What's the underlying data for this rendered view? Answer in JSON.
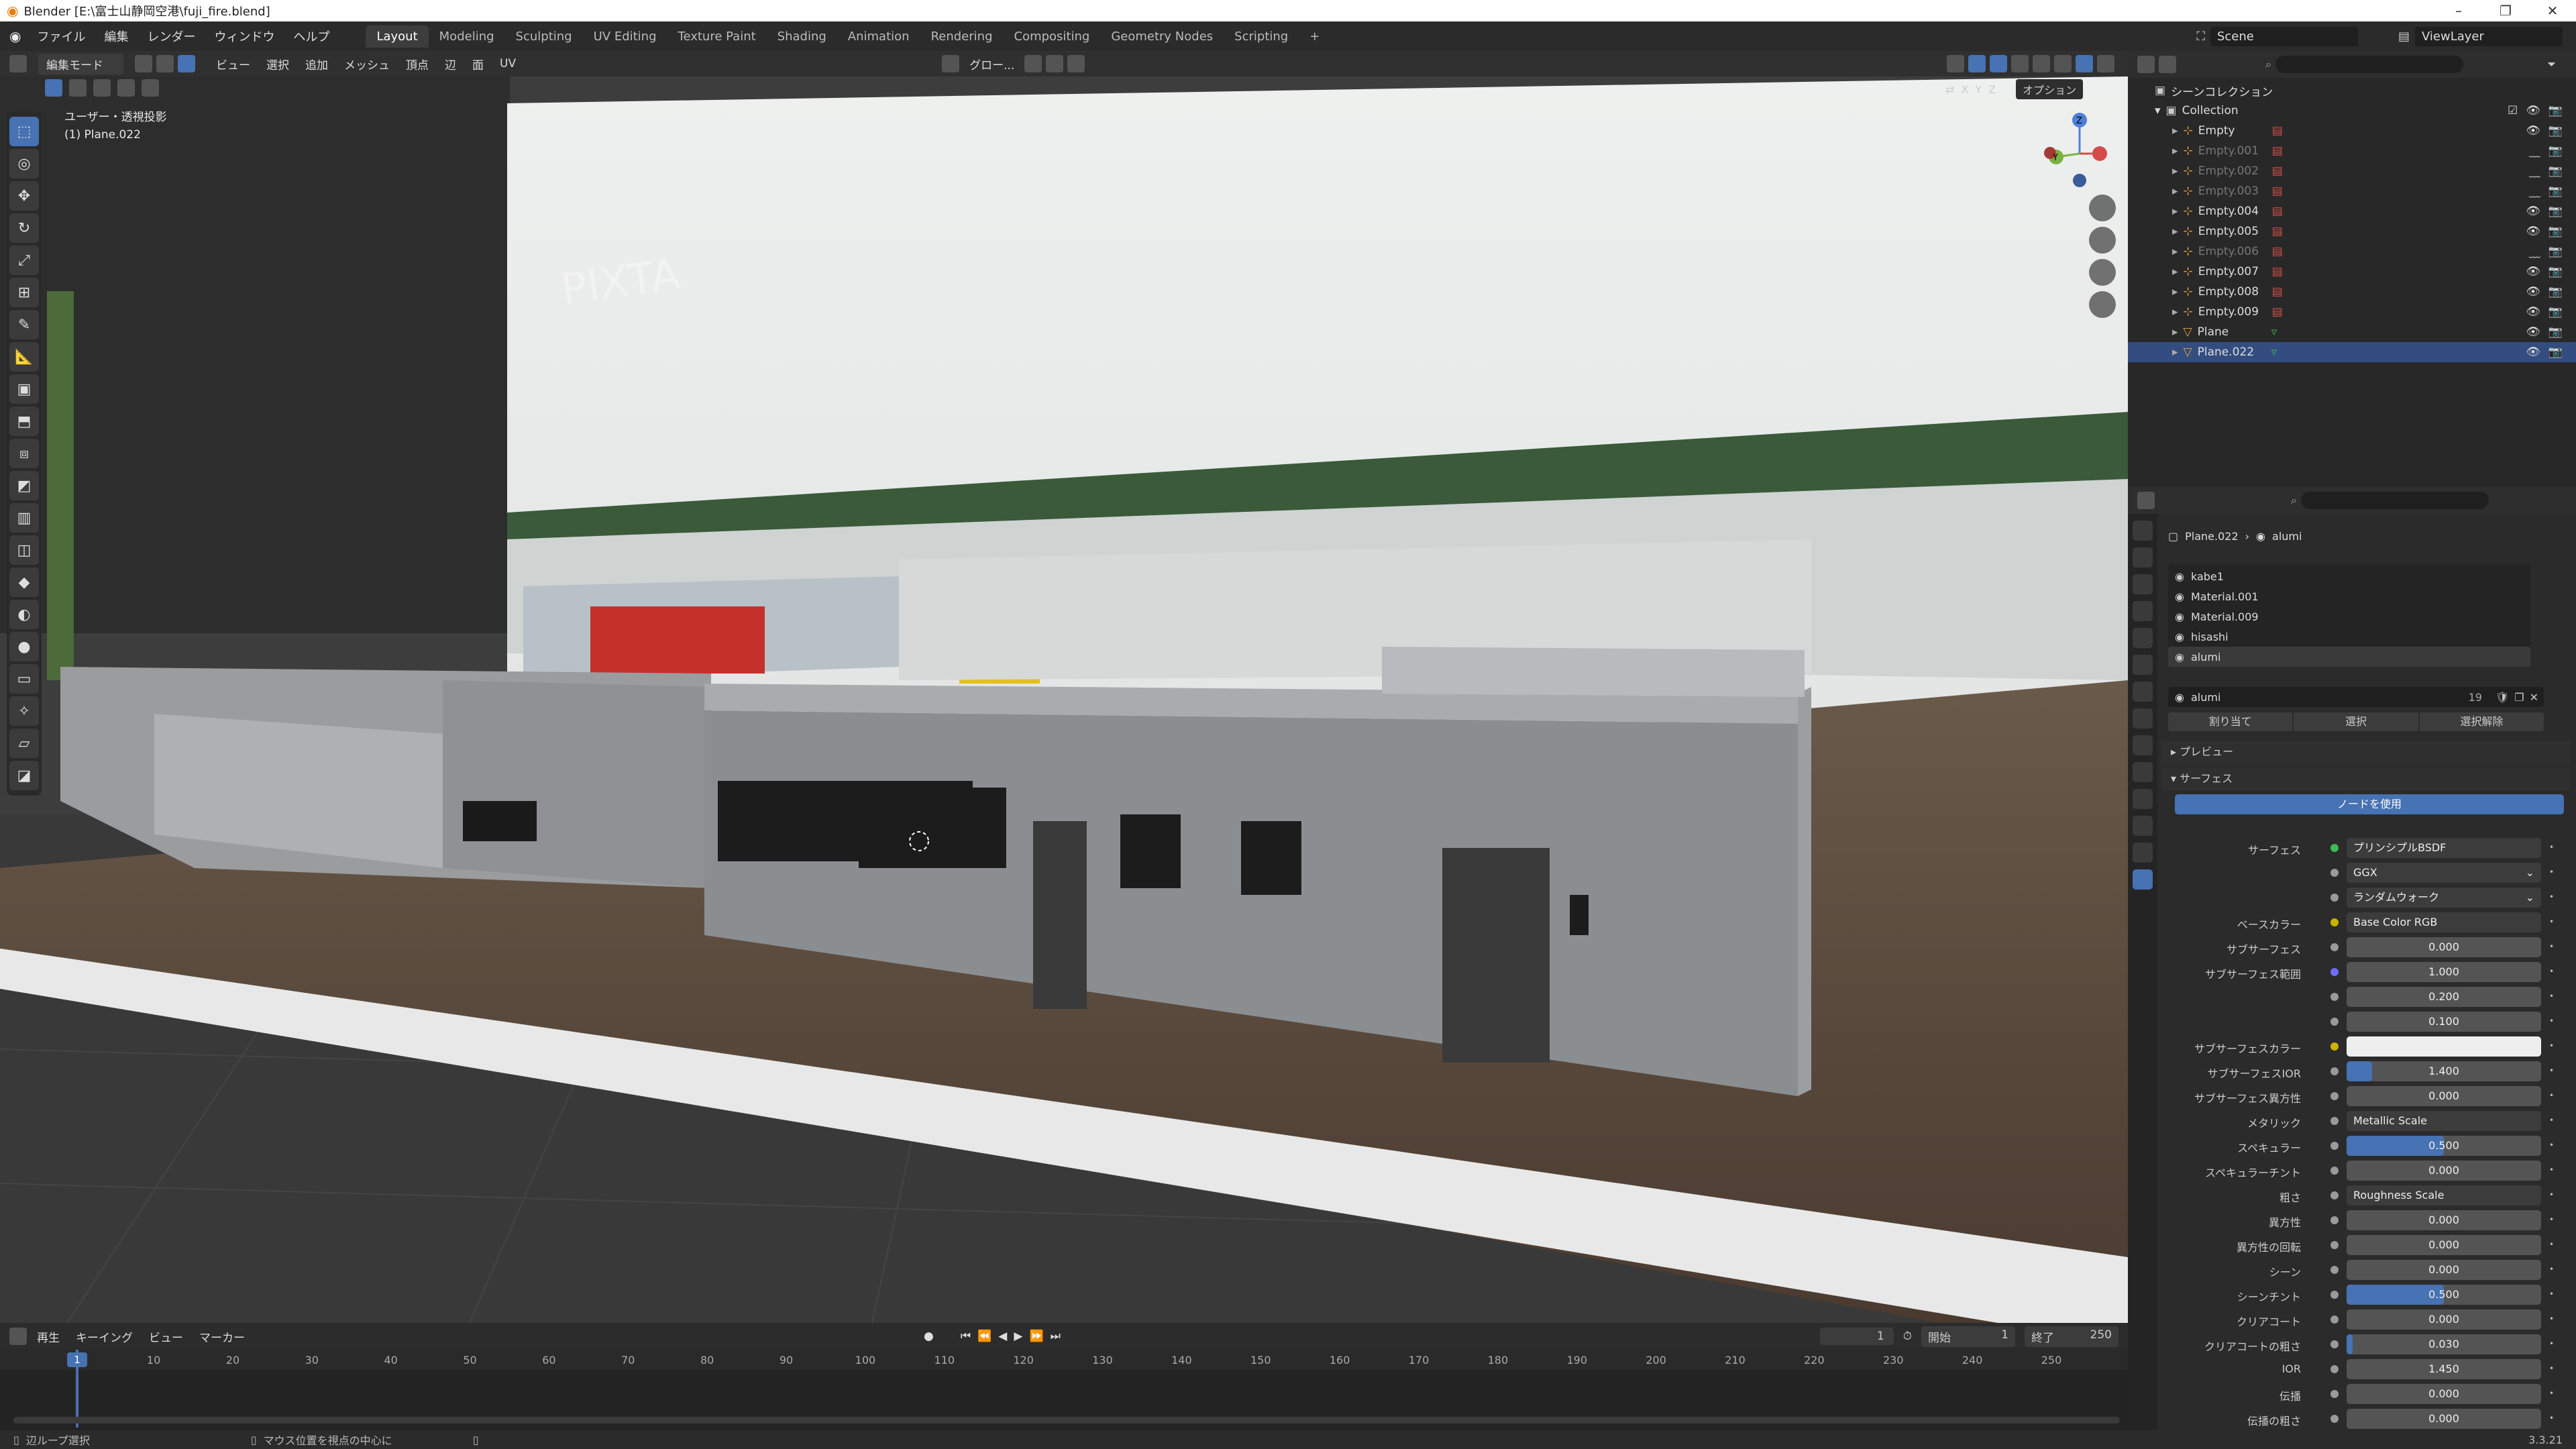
{
  "window": {
    "title": "Blender [E:\\富士山静岡空港\\fuji_fire.blend]",
    "minimize": "–",
    "maximize": "❐",
    "close": "✕"
  },
  "menu": {
    "items": [
      "ファイル",
      "編集",
      "レンダー",
      "ウィンドウ",
      "ヘルプ"
    ],
    "workspaces": [
      "Layout",
      "Modeling",
      "Sculpting",
      "UV Editing",
      "Texture Paint",
      "Shading",
      "Animation",
      "Rendering",
      "Compositing",
      "Geometry Nodes",
      "Scripting"
    ],
    "active_workspace": "Layout",
    "add": "+",
    "scene": "Scene",
    "view_layer": "ViewLayer"
  },
  "viewport_header": {
    "mode": "編集モード",
    "menus": [
      "ビュー",
      "選択",
      "追加",
      "メッシュ",
      "頂点",
      "辺",
      "面",
      "UV"
    ],
    "transform": "グロー...",
    "options": "オプション",
    "axes": [
      "X",
      "Y",
      "Z"
    ]
  },
  "viewport": {
    "view_label": "ユーザー・透視投影",
    "object_label": "(1) Plane.022",
    "watermark": "PIXTA",
    "gizmo": {
      "z": "Z",
      "y": "Y",
      "x": "X"
    }
  },
  "toolbar": {
    "tools": [
      "select-box",
      "cursor",
      "move",
      "rotate",
      "scale",
      "transform",
      "annotate",
      "measure",
      "add-cube",
      "extrude",
      "inset",
      "bevel",
      "loop-cut",
      "knife",
      "poly-build",
      "spin",
      "smooth",
      "edge-slide",
      "shrink",
      "shear",
      "rip"
    ]
  },
  "timeline": {
    "menus": [
      "再生",
      "キーイング",
      "ビュー",
      "マーカー"
    ],
    "current_frame": "1",
    "start_label": "開始",
    "start": "1",
    "end_label": "終了",
    "end": "250",
    "ticks": [
      "1",
      "10",
      "20",
      "30",
      "40",
      "50",
      "60",
      "70",
      "80",
      "90",
      "100",
      "110",
      "120",
      "130",
      "140",
      "150",
      "160",
      "170",
      "180",
      "190",
      "200",
      "210",
      "220",
      "230",
      "240",
      "250"
    ]
  },
  "status": {
    "left": "辺ループ選択",
    "middle": "マウス位置を視点の中心に",
    "version": "3.3.21"
  },
  "outliner": {
    "root": "シーンコレクション",
    "collection": "Collection",
    "items": [
      {
        "name": "Empty",
        "dim": false,
        "sel": false
      },
      {
        "name": "Empty.001",
        "dim": true,
        "sel": false
      },
      {
        "name": "Empty.002",
        "dim": true,
        "sel": false
      },
      {
        "name": "Empty.003",
        "dim": true,
        "sel": false
      },
      {
        "name": "Empty.004",
        "dim": false,
        "sel": false
      },
      {
        "name": "Empty.005",
        "dim": false,
        "sel": false
      },
      {
        "name": "Empty.006",
        "dim": true,
        "sel": false
      },
      {
        "name": "Empty.007",
        "dim": false,
        "sel": false
      },
      {
        "name": "Empty.008",
        "dim": false,
        "sel": false
      },
      {
        "name": "Empty.009",
        "dim": false,
        "sel": false
      },
      {
        "name": "Plane",
        "dim": false,
        "sel": false
      },
      {
        "name": "Plane.022",
        "dim": false,
        "sel": true
      }
    ]
  },
  "properties": {
    "breadcrumb_object": "Plane.022",
    "breadcrumb_material": "alumi",
    "materials": [
      "kabe1",
      "Material.001",
      "Material.009",
      "hisashi",
      "alumi"
    ],
    "material_name": "alumi",
    "users": "19",
    "assign": "割り当て",
    "select": "選択",
    "deselect": "選択解除",
    "preview": "プレビュー",
    "surface_section": "サーフェス",
    "use_nodes": "ノードを使用",
    "fields": [
      {
        "label": "サーフェス",
        "value": "プリンシプルBSDF",
        "type": "link",
        "dot": "#3fb950"
      },
      {
        "label": "",
        "value": "GGX",
        "type": "dropdown"
      },
      {
        "label": "",
        "value": "ランダムウォーク",
        "type": "dropdown"
      },
      {
        "label": "ベースカラー",
        "value": "Base Color RGB",
        "type": "link",
        "dot": "#c8b400"
      },
      {
        "label": "サブサーフェス",
        "value": "0.000",
        "type": "num",
        "fill": 0
      },
      {
        "label": "サブサーフェス範囲",
        "value": "1.000",
        "type": "num",
        "fill": 0,
        "dot": "#6c6cff"
      },
      {
        "label": "",
        "value": "0.200",
        "type": "num",
        "fill": 0
      },
      {
        "label": "",
        "value": "0.100",
        "type": "num",
        "fill": 0
      },
      {
        "label": "サブサーフェスカラー",
        "value": "",
        "type": "color",
        "dot": "#c8b400"
      },
      {
        "label": "サブサーフェスIOR",
        "value": "1.400",
        "type": "num",
        "fill": 0.13
      },
      {
        "label": "サブサーフェス異方性",
        "value": "0.000",
        "type": "num",
        "fill": 0
      },
      {
        "label": "メタリック",
        "value": "Metallic Scale",
        "type": "link"
      },
      {
        "label": "スペキュラー",
        "value": "0.500",
        "type": "num",
        "fill": 0.5
      },
      {
        "label": "スペキュラーチント",
        "value": "0.000",
        "type": "num",
        "fill": 0
      },
      {
        "label": "粗さ",
        "value": "Roughness Scale",
        "type": "link"
      },
      {
        "label": "異方性",
        "value": "0.000",
        "type": "num",
        "fill": 0
      },
      {
        "label": "異方性の回転",
        "value": "0.000",
        "type": "num",
        "fill": 0
      },
      {
        "label": "シーン",
        "value": "0.000",
        "type": "num",
        "fill": 0
      },
      {
        "label": "シーンチント",
        "value": "0.500",
        "type": "num",
        "fill": 0.5
      },
      {
        "label": "クリアコート",
        "value": "0.000",
        "type": "num",
        "fill": 0
      },
      {
        "label": "クリアコートの粗さ",
        "value": "0.030",
        "type": "num",
        "fill": 0.03
      },
      {
        "label": "IOR",
        "value": "1.450",
        "type": "num",
        "fill": 0
      },
      {
        "label": "伝播",
        "value": "0.000",
        "type": "num",
        "fill": 0
      },
      {
        "label": "伝播の粗さ",
        "value": "0.000",
        "type": "num",
        "fill": 0
      }
    ]
  }
}
